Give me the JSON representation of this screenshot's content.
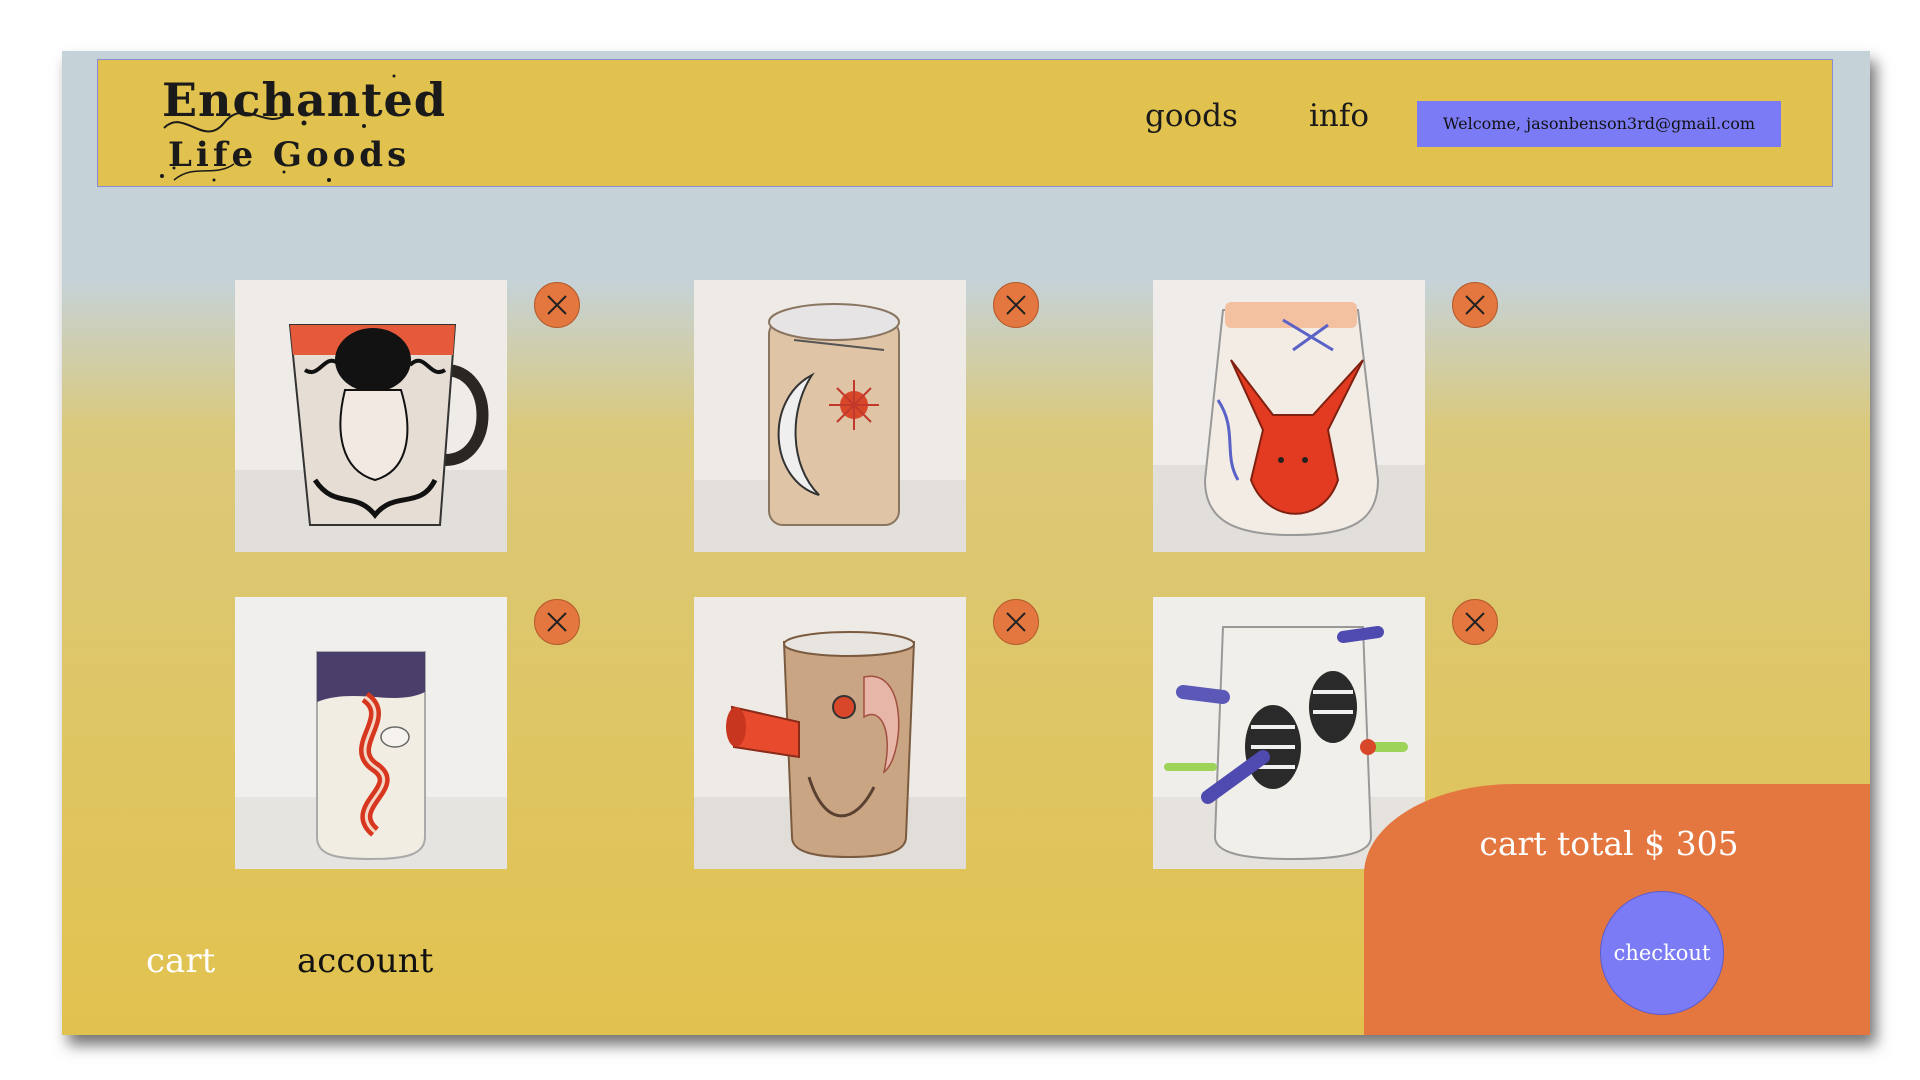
{
  "header": {
    "logo_line1": "Enchanted",
    "logo_line2": "Life Goods",
    "nav": {
      "goods": "goods",
      "info": "info"
    },
    "welcome": "Welcome, jasonbenson3rd@gmail.com"
  },
  "cart_items": [
    {
      "image": "mug-with-figure-and-black-hair",
      "remove_icon": "close-icon"
    },
    {
      "image": "tumbler-with-moon-and-sun",
      "remove_icon": "close-icon"
    },
    {
      "image": "vase-with-red-rabbit",
      "remove_icon": "close-icon"
    },
    {
      "image": "tumbler-with-red-serpent",
      "remove_icon": "close-icon"
    },
    {
      "image": "cup-with-creature-and-spout",
      "remove_icon": "close-icon"
    },
    {
      "image": "cup-with-beetles-and-spikes",
      "remove_icon": "close-icon"
    }
  ],
  "bottom_nav": {
    "cart": "cart",
    "account": "account"
  },
  "cart_summary": {
    "total": "cart total $ 305",
    "checkout": "checkout"
  },
  "colors": {
    "header_bg": "#e2c24e",
    "accent_orange": "#e4773f",
    "accent_purple": "#7b7cf5",
    "top_bg": "#c5d2d8"
  }
}
